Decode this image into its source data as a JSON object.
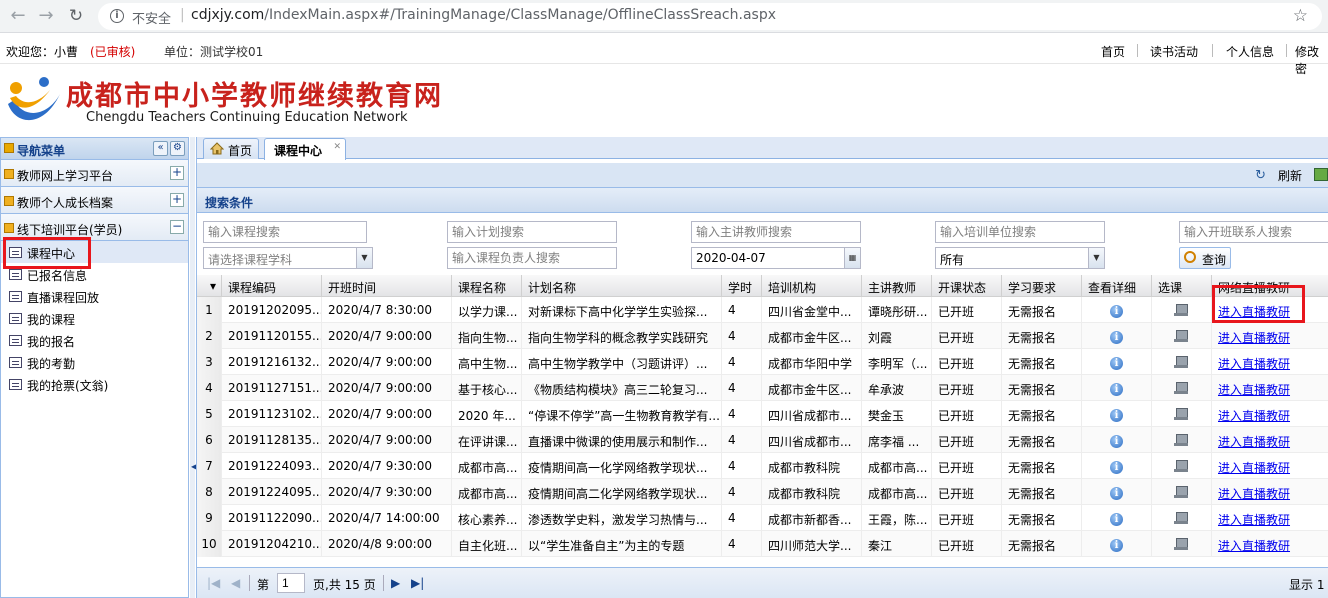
{
  "browser": {
    "security": "不安全",
    "url_host": "cdjxjy.com",
    "url_path": "/IndexMain.aspx#/TrainingManage/ClassManage/OfflineClassSreach.aspx"
  },
  "topbar": {
    "welcome": "欢迎您：小曹",
    "audit": "(已审核)",
    "unit": "单位：测试学校01",
    "links": [
      "首页",
      "读书活动",
      "个人信息",
      "修改密"
    ]
  },
  "banner": {
    "title": "成都市中小学教师继续教育网",
    "subtitle": "Chengdu Teachers Continuing Education Network"
  },
  "nav": {
    "title": "导航菜单",
    "sections": [
      "教师网上学习平台",
      "教师个人成长档案",
      "线下培训平台(学员)"
    ],
    "items": [
      "课程中心",
      "已报名信息",
      "直播课程回放",
      "我的课程",
      "我的报名",
      "我的考勤",
      "我的抢票(文翁)"
    ]
  },
  "tabs": [
    "首页",
    "课程中心"
  ],
  "toolbar": {
    "refresh": "刷新"
  },
  "search": {
    "title": "搜索条件",
    "course_ph": "输入课程搜索",
    "plan_ph": "输入计划搜索",
    "teacher_ph": "输入主讲教师搜索",
    "unit_ph": "输入培训单位搜索",
    "contact_ph": "输入开班联系人搜索",
    "subject_ph": "请选择课程学科",
    "owner_ph": "输入课程负责人搜索",
    "date": "2020-04-07",
    "status": "所有",
    "query": "查询"
  },
  "grid": {
    "headers": [
      "课程编码",
      "开班时间",
      "课程名称",
      "计划名称",
      "学时",
      "培训机构",
      "主讲教师",
      "开课状态",
      "学习要求",
      "查看详细",
      "选课",
      "网络直播教研"
    ],
    "rows": [
      [
        "1",
        "20191202095...",
        "2020/4/7 8:30:00",
        "以学力课...",
        "对新课标下高中化学学生实验探...",
        "4",
        "四川省金堂中...",
        "谭晓彤研...",
        "已开班",
        "无需报名",
        "进入直播教研"
      ],
      [
        "2",
        "20191120155...",
        "2020/4/7 9:00:00",
        "指向生物...",
        "指向生物学科的概念教学实践研究",
        "4",
        "成都市金牛区...",
        "刘霞",
        "已开班",
        "无需报名",
        "进入直播教研"
      ],
      [
        "3",
        "20191216132...",
        "2020/4/7 9:00:00",
        "高中生物...",
        "高中生物学教学中（习题讲评）...",
        "4",
        "成都市华阳中学",
        "李明军（...",
        "已开班",
        "无需报名",
        "进入直播教研"
      ],
      [
        "4",
        "20191127151...",
        "2020/4/7 9:00:00",
        "基于核心...",
        "《物质结构模块》高三二轮复习...",
        "4",
        "成都市金牛区...",
        "牟承波",
        "已开班",
        "无需报名",
        "进入直播教研"
      ],
      [
        "5",
        "20191123102...",
        "2020/4/7 9:00:00",
        "2020 年...",
        "“停课不停学”高一生物教育教学有...",
        "4",
        "四川省成都市...",
        "樊金玉",
        "已开班",
        "无需报名",
        "进入直播教研"
      ],
      [
        "6",
        "20191128135...",
        "2020/4/7 9:00:00",
        "在评讲课...",
        "直播课中微课的使用展示和制作...",
        "4",
        "四川省成都市...",
        "席李福 ...",
        "已开班",
        "无需报名",
        "进入直播教研"
      ],
      [
        "7",
        "20191224093...",
        "2020/4/7 9:30:00",
        "成都市高...",
        "疫情期间高一化学网络教学现状...",
        "4",
        "成都市教科院",
        "成都市高...",
        "已开班",
        "无需报名",
        "进入直播教研"
      ],
      [
        "8",
        "20191224095...",
        "2020/4/7 9:30:00",
        "成都市高...",
        "疫情期间高二化学网络教学现状...",
        "4",
        "成都市教科院",
        "成都市高...",
        "已开班",
        "无需报名",
        "进入直播教研"
      ],
      [
        "9",
        "20191122090...",
        "2020/4/7 14:00:00",
        "核心素养...",
        "渗透数学史料，激发学习热情与...",
        "4",
        "成都市新都香...",
        "王霞，陈...",
        "已开班",
        "无需报名",
        "进入直播教研"
      ],
      [
        "10",
        "20191204210...",
        "2020/4/8 9:00:00",
        "自主化班...",
        "以“学生准备自主”为主的专题",
        "4",
        "四川师范大学...",
        "秦江",
        "已开班",
        "无需报名",
        "进入直播教研"
      ]
    ]
  },
  "pager": {
    "page_label": "第",
    "page": "1",
    "total": "页,共 15 页",
    "display": "显示 1 -"
  }
}
